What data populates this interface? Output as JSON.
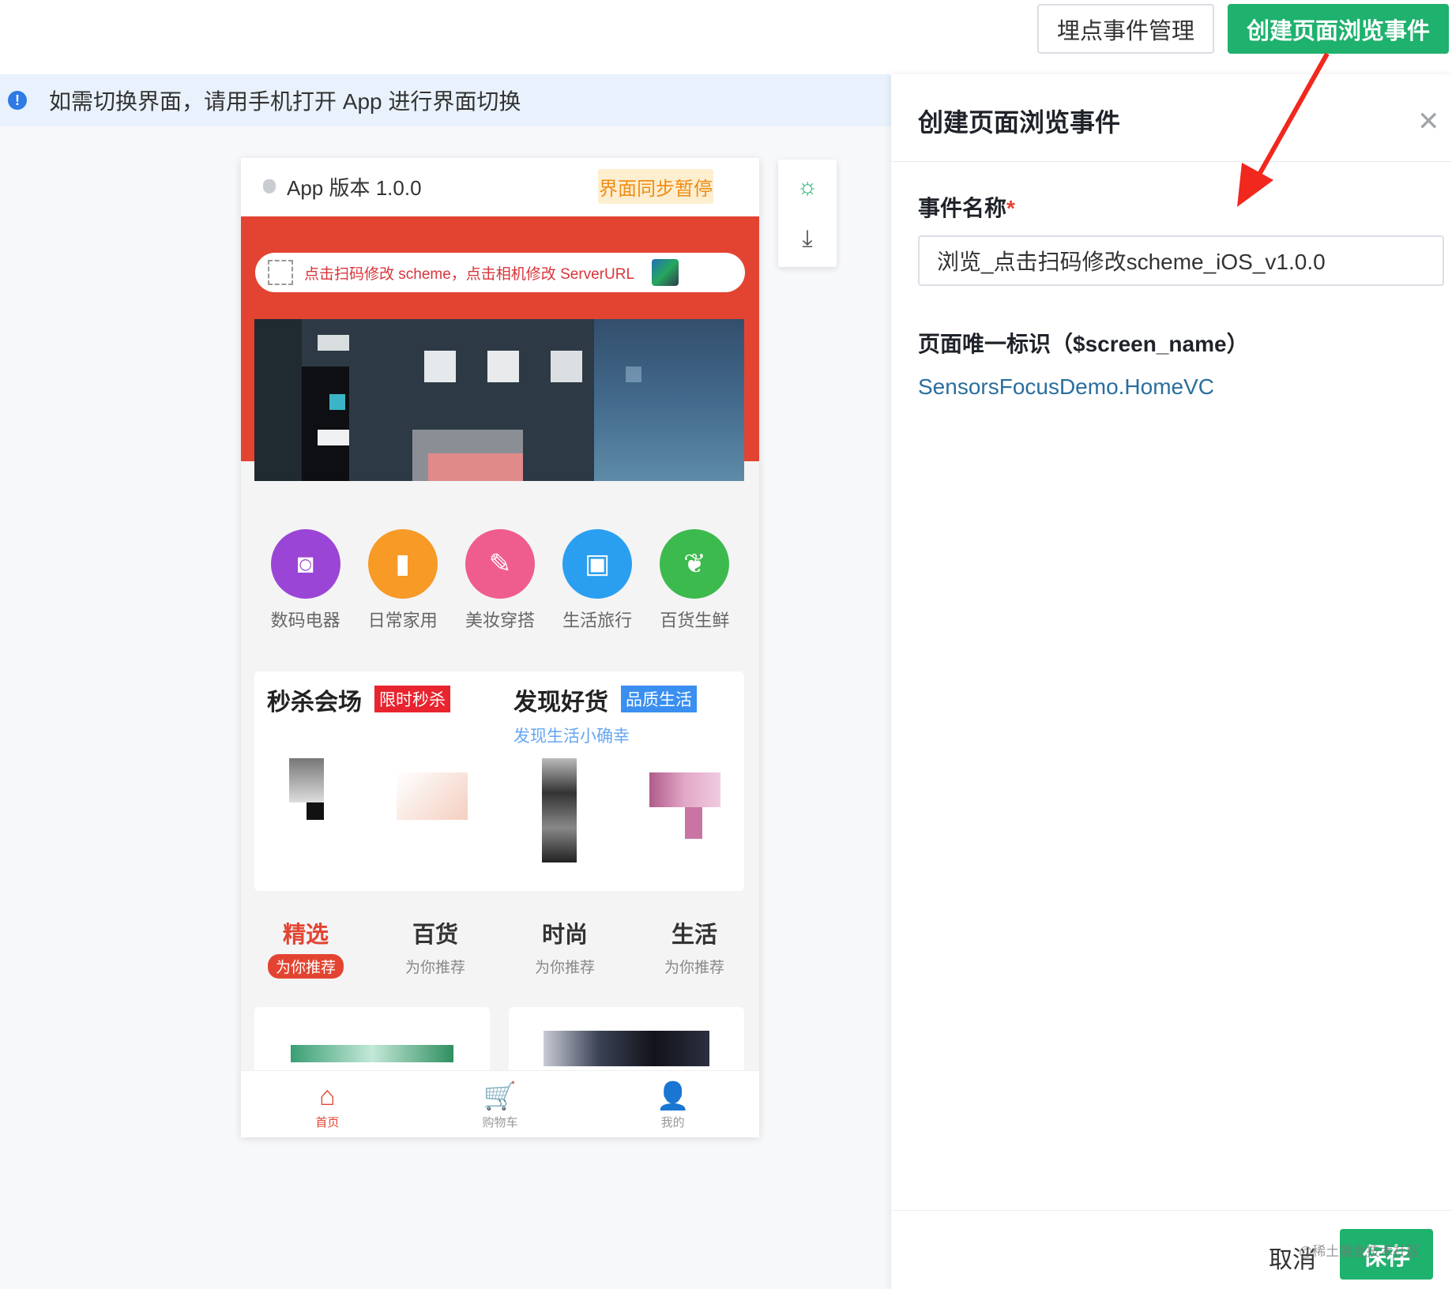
{
  "toolbar": {
    "manage_label": "埋点事件管理",
    "create_label": "创建页面浏览事件"
  },
  "notice": {
    "icon": "info-icon",
    "text": "如需切换界面，请用手机打开 App 进行界面切换"
  },
  "phone": {
    "app_version": "App 版本 1.0.0",
    "sync_status": "界面同步暂停",
    "scan_hint": "点击扫码修改 scheme，点击相机修改 ServerURL",
    "categories": [
      {
        "label": "数码电器",
        "icon": "camera-icon",
        "color": "#9b45d6"
      },
      {
        "label": "日常家用",
        "icon": "tissue-icon",
        "color": "#f79a26"
      },
      {
        "label": "美妆穿搭",
        "icon": "makeup-icon",
        "color": "#ef5d8f"
      },
      {
        "label": "生活旅行",
        "icon": "luggage-icon",
        "color": "#2a9ff0"
      },
      {
        "label": "百货生鲜",
        "icon": "vegetable-icon",
        "color": "#3dba4e"
      }
    ],
    "flash_sale": {
      "title": "秒杀会场",
      "tag": "限时秒杀"
    },
    "discover": {
      "title": "发现好货",
      "tag": "品质生活",
      "subtitle": "发现生活小确幸"
    },
    "feed_tabs": [
      {
        "title": "精选",
        "sub": "为你推荐"
      },
      {
        "title": "百货",
        "sub": "为你推荐"
      },
      {
        "title": "时尚",
        "sub": "为你推荐"
      },
      {
        "title": "生活",
        "sub": "为你推荐"
      }
    ],
    "tabbar": [
      {
        "label": "首页",
        "icon": "home-icon"
      },
      {
        "label": "购物车",
        "icon": "cart-icon"
      },
      {
        "label": "我的",
        "icon": "user-icon"
      }
    ]
  },
  "tools": {
    "bulb_icon": "lightbulb-icon",
    "download_icon": "download-icon"
  },
  "drawer": {
    "title": "创建页面浏览事件",
    "event_name_label": "事件名称",
    "event_name_value": "浏览_点击扫码修改scheme_iOS_v1.0.0",
    "screen_name_label": "页面唯一标识（$screen_name）",
    "screen_name_value": "SensorsFocusDemo.HomeVC",
    "cancel_label": "取消",
    "save_label": "保存",
    "watermark": "@稀土掘金技术社区"
  },
  "colors": {
    "accent": "#1fb16e",
    "brand_red": "#e34432",
    "info_blue": "#2f7ae5"
  }
}
